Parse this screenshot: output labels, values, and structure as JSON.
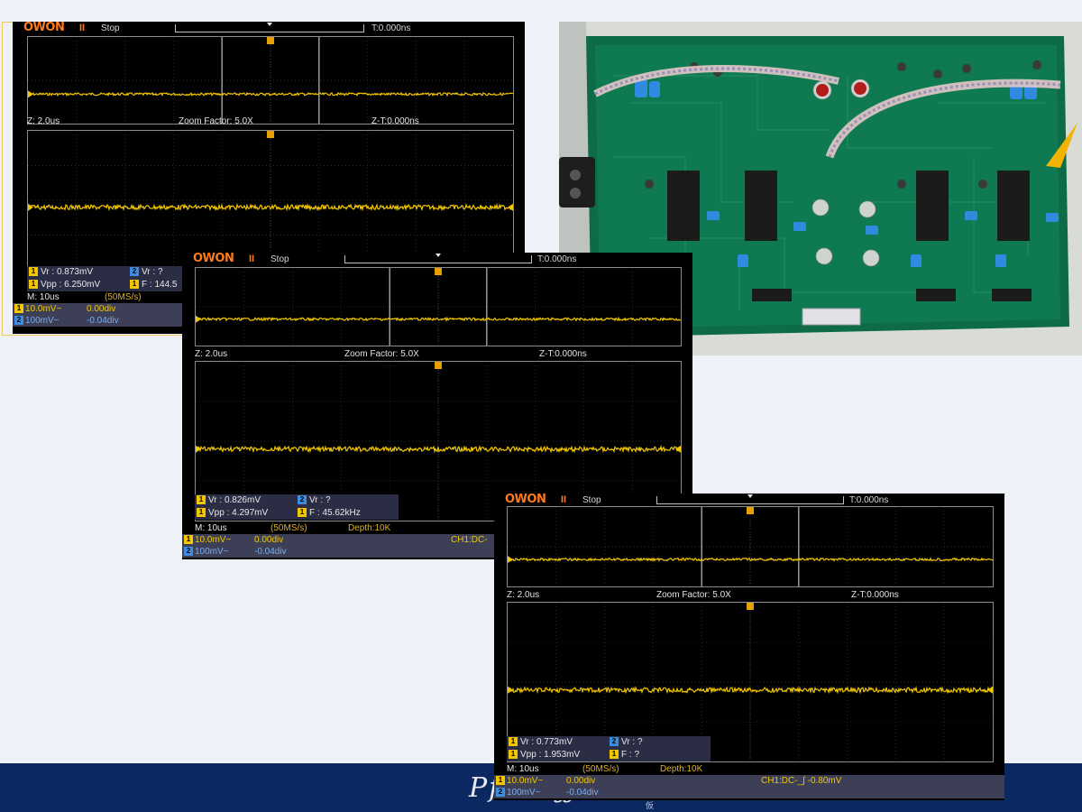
{
  "scopes": [
    {
      "logo": "OWON",
      "run_mark": "II",
      "state": "Stop",
      "trigger_time": "T:0.000ns",
      "zoom": {
        "z": "Z: 2.0us",
        "factor": "Zoom Factor: 5.0X",
        "zt": "Z-T:0.000ns"
      },
      "meas": {
        "ch1_vr": "Vr : 0.873mV",
        "ch2_vr": "Vr :   ?",
        "ch1_vpp": "Vpp : 6.250mV",
        "ch1_f": "F : 144.5"
      },
      "timebase": "M: 10us",
      "sample": "(50MS/s)",
      "ch1": {
        "scale": "10.0mV~",
        "offset": "0.00div"
      },
      "ch2": {
        "scale": "100mV~",
        "offset": "-0.04div"
      }
    },
    {
      "logo": "OWON",
      "run_mark": "II",
      "state": "Stop",
      "trigger_time": "T:0.000ns",
      "zoom": {
        "z": "Z: 2.0us",
        "factor": "Zoom Factor: 5.0X",
        "zt": "Z-T:0.000ns"
      },
      "meas": {
        "ch1_vr": "Vr : 0.826mV",
        "ch2_vr": "Vr :    ?",
        "ch1_vpp": "Vpp : 4.297mV",
        "ch1_f": "F : 45.62kHz"
      },
      "timebase": "M: 10us",
      "sample": "(50MS/s)",
      "depth": "Depth:10K",
      "ch1": {
        "scale": "10.0mV~",
        "offset": "0.00div"
      },
      "ch2": {
        "scale": "100mV~",
        "offset": "-0.04div"
      },
      "trigger": "CH1:DC-"
    },
    {
      "logo": "OWON",
      "run_mark": "II",
      "state": "Stop",
      "trigger_time": "T:0.000ns",
      "zoom": {
        "z": "Z: 2.0us",
        "factor": "Zoom Factor: 5.0X",
        "zt": "Z-T:0.000ns"
      },
      "meas": {
        "ch1_vr": "Vr : 0.773mV",
        "ch2_vr": "Vr :   ?",
        "ch1_vpp": "Vpp : 1.953mV",
        "ch1_f": "F :   ?"
      },
      "timebase": "M: 10us",
      "sample": "(50MS/s)",
      "depth": "Depth:10K",
      "ch1": {
        "scale": "10.0mV~",
        "offset": "0.00div"
      },
      "ch2": {
        "scale": "100mV~",
        "offset": "-0.04div"
      },
      "trigger": "CH1:DC-_∫ -0.80mV"
    }
  ],
  "colors": {
    "trace": "#f2c700",
    "ch2": "#3c8ce0",
    "grid": "#2a2a2a",
    "logo": "#ff7a1a",
    "footer": "#0c2860"
  },
  "footer": {
    "script": "Pf  ··· ⁄ʃʃı",
    "small": "仮"
  }
}
